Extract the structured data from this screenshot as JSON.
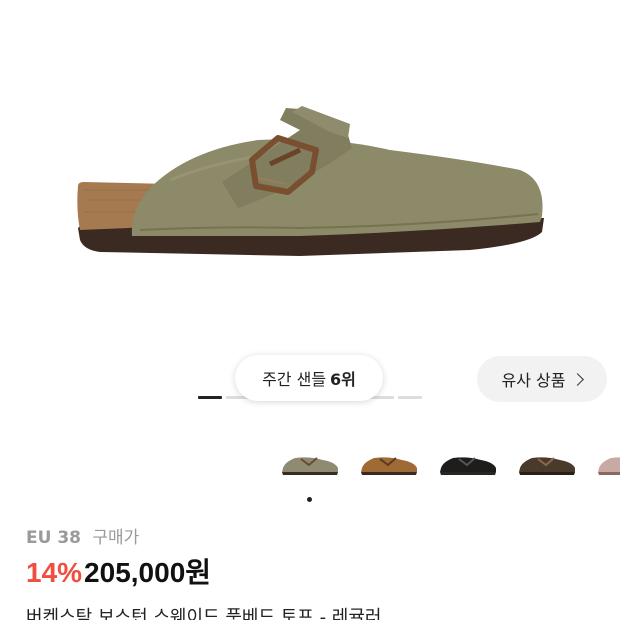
{
  "product_image": {
    "description_icon": "clog-shoe-image"
  },
  "rank_badge": {
    "prefix": "주간 샌들",
    "rank": "6위"
  },
  "similar_products": {
    "label": "유사 상품"
  },
  "color_thumbnails": [
    {
      "name": "taupe",
      "color": "#8f8b73"
    },
    {
      "name": "mink",
      "color": "#a06a35"
    },
    {
      "name": "black",
      "color": "#1d1d1d"
    },
    {
      "name": "dark-brown",
      "color": "#4a3a2c"
    },
    {
      "name": "pink",
      "color": "#c8a9a5"
    }
  ],
  "purchase_info": {
    "size": "EU 38",
    "price_type": "구매가",
    "discount": "14%",
    "price": "205,000원"
  },
  "product_title": "버켄스탁 보스턴 스웨이드 풋베드 토프 - 레귤러",
  "colors": {
    "discount_red": "#f04e3e",
    "indicator_active": "#222222",
    "indicator_inactive": "#dddddd"
  }
}
